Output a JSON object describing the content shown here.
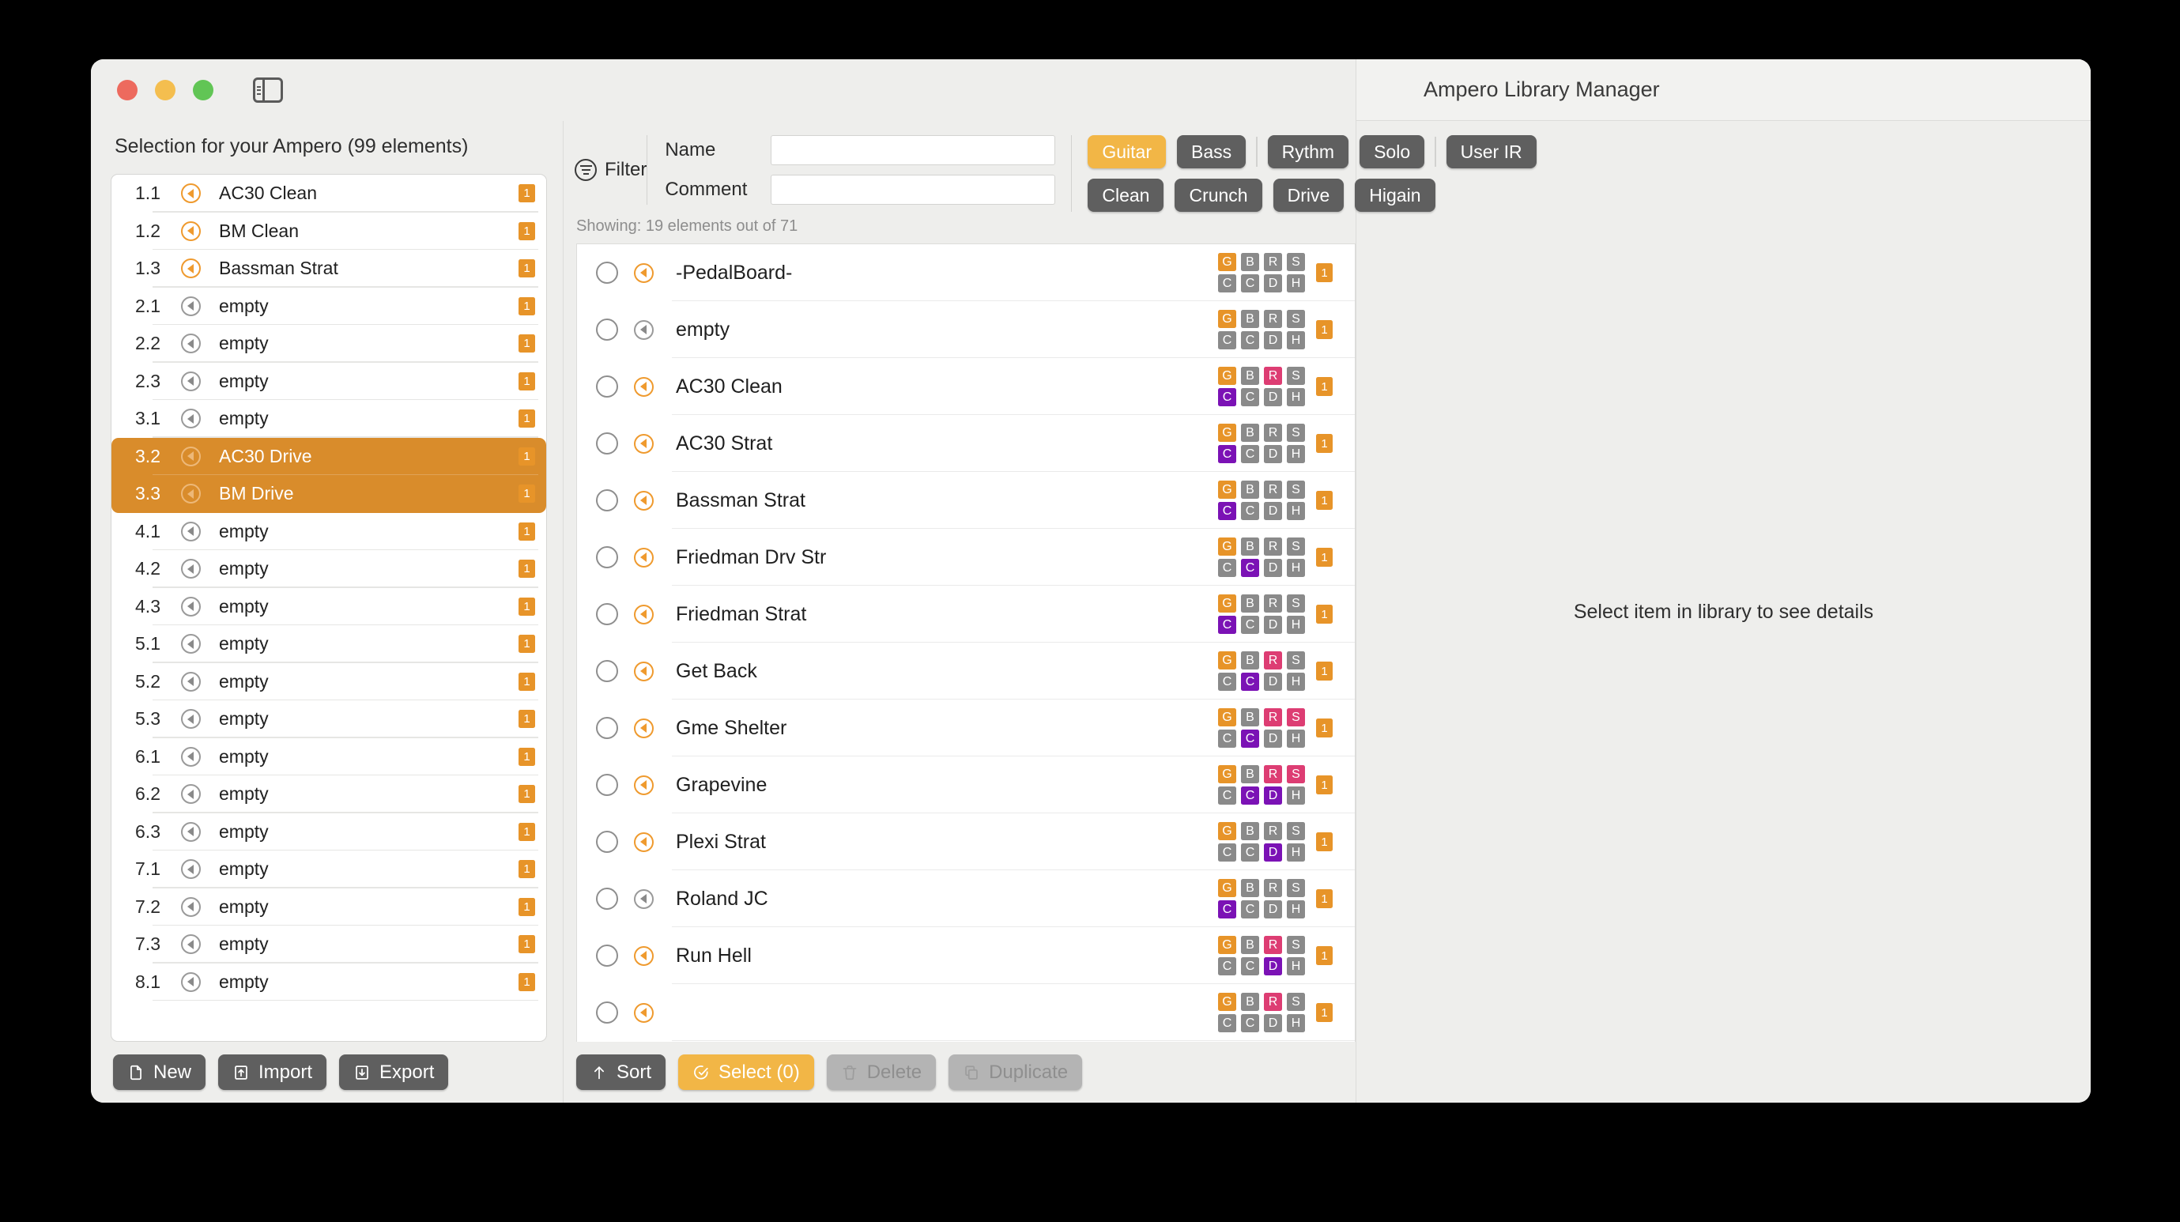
{
  "window": {
    "title": "Ampero Library Manager",
    "traffic_lights": [
      "close",
      "minimize",
      "maximize"
    ]
  },
  "left_panel": {
    "header": "Selection for your Ampero (99 elements)",
    "rows": [
      {
        "index": "1.1",
        "name": "AC30 Clean",
        "speaker": "on",
        "badge": "1",
        "selected": false
      },
      {
        "index": "1.2",
        "name": "BM Clean",
        "speaker": "on",
        "badge": "1",
        "selected": false
      },
      {
        "index": "1.3",
        "name": "Bassman Strat",
        "speaker": "on",
        "badge": "1",
        "selected": false
      },
      {
        "index": "2.1",
        "name": "empty",
        "speaker": "off",
        "badge": "1",
        "selected": false
      },
      {
        "index": "2.2",
        "name": "empty",
        "speaker": "off",
        "badge": "1",
        "selected": false
      },
      {
        "index": "2.3",
        "name": "empty",
        "speaker": "off",
        "badge": "1",
        "selected": false
      },
      {
        "index": "3.1",
        "name": "empty",
        "speaker": "off",
        "badge": "1",
        "selected": false
      },
      {
        "index": "3.2",
        "name": "AC30 Drive",
        "speaker": "off",
        "badge": "1",
        "selected": true
      },
      {
        "index": "3.3",
        "name": "BM Drive",
        "speaker": "off",
        "badge": "1",
        "selected": true
      },
      {
        "index": "4.1",
        "name": "empty",
        "speaker": "off",
        "badge": "1",
        "selected": false
      },
      {
        "index": "4.2",
        "name": "empty",
        "speaker": "off",
        "badge": "1",
        "selected": false
      },
      {
        "index": "4.3",
        "name": "empty",
        "speaker": "off",
        "badge": "1",
        "selected": false
      },
      {
        "index": "5.1",
        "name": "empty",
        "speaker": "off",
        "badge": "1",
        "selected": false
      },
      {
        "index": "5.2",
        "name": "empty",
        "speaker": "off",
        "badge": "1",
        "selected": false
      },
      {
        "index": "5.3",
        "name": "empty",
        "speaker": "off",
        "badge": "1",
        "selected": false
      },
      {
        "index": "6.1",
        "name": "empty",
        "speaker": "off",
        "badge": "1",
        "selected": false
      },
      {
        "index": "6.2",
        "name": "empty",
        "speaker": "off",
        "badge": "1",
        "selected": false
      },
      {
        "index": "6.3",
        "name": "empty",
        "speaker": "off",
        "badge": "1",
        "selected": false
      },
      {
        "index": "7.1",
        "name": "empty",
        "speaker": "off",
        "badge": "1",
        "selected": false
      },
      {
        "index": "7.2",
        "name": "empty",
        "speaker": "off",
        "badge": "1",
        "selected": false
      },
      {
        "index": "7.3",
        "name": "empty",
        "speaker": "off",
        "badge": "1",
        "selected": false
      },
      {
        "index": "8.1",
        "name": "empty",
        "speaker": "off",
        "badge": "1",
        "selected": false
      }
    ],
    "toolbar": [
      {
        "label": "New",
        "icon": "new-file-icon",
        "state": "enabled"
      },
      {
        "label": "Import",
        "icon": "import-icon",
        "state": "enabled"
      },
      {
        "label": "Export",
        "icon": "export-icon",
        "state": "enabled"
      }
    ]
  },
  "filter": {
    "label": "Filter",
    "icon": "filter-icon",
    "fields": [
      {
        "label": "Name",
        "value": "",
        "placeholder": ""
      },
      {
        "label": "Comment",
        "value": "",
        "placeholder": ""
      }
    ],
    "category_row_1": [
      {
        "label": "Guitar",
        "active": true
      },
      {
        "label": "Bass",
        "active": false
      },
      {
        "divider": true
      },
      {
        "label": "Rythm",
        "active": false
      },
      {
        "label": "Solo",
        "active": false
      },
      {
        "divider": true
      },
      {
        "label": "User IR",
        "active": false
      }
    ],
    "category_row_2": [
      {
        "label": "Clean",
        "active": false
      },
      {
        "label": "Crunch",
        "active": false
      },
      {
        "label": "Drive",
        "active": false
      },
      {
        "label": "Higain",
        "active": false
      }
    ],
    "showing": "Showing: 19 elements out of 71"
  },
  "library": {
    "tag_labels_top": [
      "G",
      "B",
      "R",
      "S"
    ],
    "tag_labels_bottom": [
      "C",
      "C",
      "D",
      "H"
    ],
    "rows": [
      {
        "name": "-PedalBoard-",
        "speaker": "on",
        "badge": "1",
        "tags_top": [
          "orange",
          "gray",
          "gray",
          "gray"
        ],
        "tags_bottom": [
          "gray",
          "gray",
          "gray",
          "gray"
        ]
      },
      {
        "name": "empty",
        "speaker": "off",
        "badge": "1",
        "tags_top": [
          "orange",
          "gray",
          "gray",
          "gray"
        ],
        "tags_bottom": [
          "gray",
          "gray",
          "gray",
          "gray"
        ]
      },
      {
        "name": "AC30 Clean",
        "speaker": "on",
        "badge": "1",
        "tags_top": [
          "orange",
          "gray",
          "pink",
          "gray"
        ],
        "tags_bottom": [
          "purple",
          "gray",
          "gray",
          "gray"
        ]
      },
      {
        "name": "AC30 Strat",
        "speaker": "on",
        "badge": "1",
        "tags_top": [
          "orange",
          "gray",
          "gray",
          "gray"
        ],
        "tags_bottom": [
          "purple",
          "gray",
          "gray",
          "gray"
        ]
      },
      {
        "name": "Bassman Strat",
        "speaker": "on",
        "badge": "1",
        "tags_top": [
          "orange",
          "gray",
          "gray",
          "gray"
        ],
        "tags_bottom": [
          "purple",
          "gray",
          "gray",
          "gray"
        ]
      },
      {
        "name": "Friedman Drv Str",
        "speaker": "on",
        "badge": "1",
        "tags_top": [
          "orange",
          "gray",
          "gray",
          "gray"
        ],
        "tags_bottom": [
          "gray",
          "purple",
          "gray",
          "gray"
        ]
      },
      {
        "name": "Friedman Strat",
        "speaker": "on",
        "badge": "1",
        "tags_top": [
          "orange",
          "gray",
          "gray",
          "gray"
        ],
        "tags_bottom": [
          "purple",
          "gray",
          "gray",
          "gray"
        ]
      },
      {
        "name": "Get Back",
        "speaker": "on",
        "badge": "1",
        "tags_top": [
          "orange",
          "gray",
          "pink",
          "gray"
        ],
        "tags_bottom": [
          "gray",
          "purple",
          "gray",
          "gray"
        ]
      },
      {
        "name": "Gme Shelter",
        "speaker": "on",
        "badge": "1",
        "tags_top": [
          "orange",
          "gray",
          "pink",
          "pink"
        ],
        "tags_bottom": [
          "gray",
          "purple",
          "gray",
          "gray"
        ]
      },
      {
        "name": "Grapevine",
        "speaker": "on",
        "badge": "1",
        "tags_top": [
          "orange",
          "gray",
          "pink",
          "pink"
        ],
        "tags_bottom": [
          "gray",
          "purple",
          "purple",
          "gray"
        ]
      },
      {
        "name": "Plexi Strat",
        "speaker": "on",
        "badge": "1",
        "tags_top": [
          "orange",
          "gray",
          "gray",
          "gray"
        ],
        "tags_bottom": [
          "gray",
          "gray",
          "purple",
          "gray"
        ]
      },
      {
        "name": "Roland JC",
        "speaker": "off",
        "badge": "1",
        "tags_top": [
          "orange",
          "gray",
          "gray",
          "gray"
        ],
        "tags_bottom": [
          "purple",
          "gray",
          "gray",
          "gray"
        ]
      },
      {
        "name": "Run Hell",
        "speaker": "on",
        "badge": "1",
        "tags_top": [
          "orange",
          "gray",
          "pink",
          "gray"
        ],
        "tags_bottom": [
          "gray",
          "gray",
          "purple",
          "gray"
        ]
      },
      {
        "name": "",
        "speaker": "on",
        "badge": "1",
        "tags_top": [
          "orange",
          "gray",
          "pink",
          "gray"
        ],
        "tags_bottom": [
          "gray",
          "gray",
          "gray",
          "gray"
        ]
      }
    ],
    "toolbar": [
      {
        "label": "Sort",
        "icon": "sort-arrow-icon",
        "state": "enabled"
      },
      {
        "label": "Select (0)",
        "icon": "select-icon",
        "state": "active"
      },
      {
        "label": "Delete",
        "icon": "trash-icon",
        "state": "disabled"
      },
      {
        "label": "Duplicate",
        "icon": "duplicate-icon",
        "state": "disabled"
      }
    ]
  },
  "detail_panel": {
    "placeholder": "Select item in library to see details"
  },
  "colors": {
    "accent_orange": "#e79429",
    "accent_amber": "#f2b646",
    "selection_orange": "#d98c2b",
    "tag_pink": "#dd3d73",
    "tag_purple": "#7b12b5",
    "tag_gray": "#8a8a8a",
    "pill_gray": "#5f5f5f"
  }
}
